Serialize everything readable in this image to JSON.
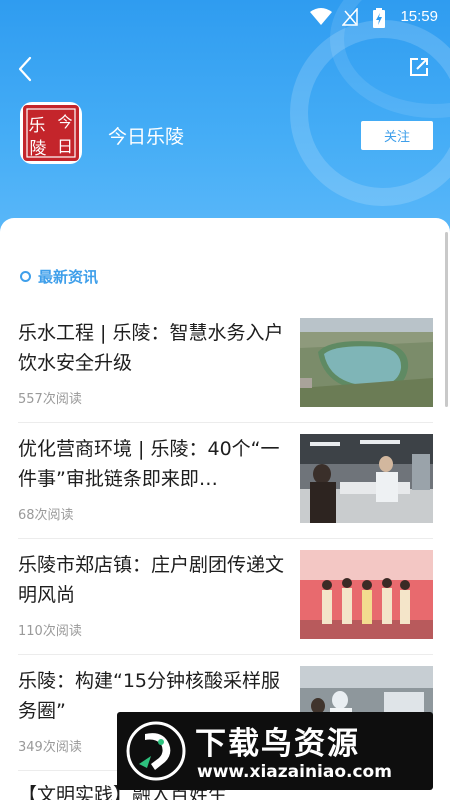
{
  "status_bar": {
    "time": "15:59",
    "icons": [
      "wifi-icon",
      "signal-off-icon",
      "battery-charging-icon"
    ]
  },
  "header": {
    "back_icon": "chevron-left-icon",
    "share_icon": "share-icon",
    "logo_chars": [
      "乐",
      "今",
      "陵",
      "日"
    ],
    "channel_name": "今日乐陵",
    "follow_label": "关注"
  },
  "section": {
    "title": "最新资讯"
  },
  "news": [
    {
      "title": "乐水工程 | 乐陵：智慧水务入户 饮水安全升级",
      "reads": "557次阅读",
      "thumb": "reservoir"
    },
    {
      "title": "优化营商环境 | 乐陵：40个“一件事”审批链条即来即…",
      "reads": "68次阅读",
      "thumb": "service-hall"
    },
    {
      "title": "乐陵市郑店镇：庄户剧团传递文明风尚",
      "reads": "110次阅读",
      "thumb": "stage-performance"
    },
    {
      "title": "乐陵：构建“15分钟核酸采样服务圈”",
      "reads": "349次阅读",
      "thumb": "testing-site"
    }
  ],
  "partial_item": {
    "title": "【文明实践】融入百姓生"
  },
  "watermark": {
    "title": "下载鸟资源",
    "url": "www.xiazainiao.com"
  },
  "colors": {
    "accent": "#3f9fea",
    "header_top": "#2f9cf0",
    "logo_red": "#c4252b"
  }
}
